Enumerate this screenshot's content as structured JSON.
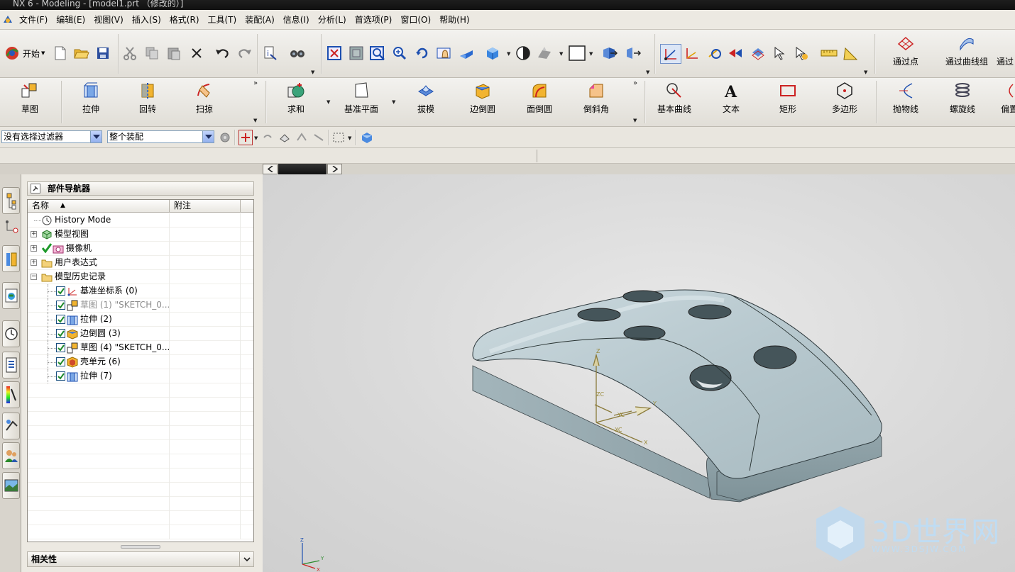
{
  "window": {
    "title": "NX 6 - Modeling - [model1.prt （修改的）]"
  },
  "menu": [
    "文件(F)",
    "编辑(E)",
    "视图(V)",
    "插入(S)",
    "格式(R)",
    "工具(T)",
    "装配(A)",
    "信息(I)",
    "分析(L)",
    "首选项(P)",
    "窗口(O)",
    "帮助(H)"
  ],
  "toolbar_standard": {
    "start_label": "开始",
    "through_points": "通过点",
    "through_curves": "通过曲线组",
    "through_partial": "通过"
  },
  "toolbar_features": {
    "sketch": "草图",
    "extrude": "拉伸",
    "revolve": "回转",
    "sweep": "扫掠",
    "unite": "求和",
    "datum_plane": "基准平面",
    "draft": "拔模",
    "edge_blend": "边倒圆",
    "face_blend": "面倒圆",
    "chamfer": "倒斜角",
    "basic_curves": "基本曲线",
    "text": "文本",
    "rectangle": "矩形",
    "polygon": "多边形",
    "parabola": "抛物线",
    "helix": "螺旋线",
    "offset_partial": "偏置"
  },
  "selection_bar": {
    "filter": "没有选择过滤器",
    "scope": "整个装配"
  },
  "navigator": {
    "title": "部件导航器",
    "col_name": "名称",
    "col_note": "附注",
    "items": [
      {
        "label": "History Mode",
        "icon": "clock-icon",
        "level": 0
      },
      {
        "label": "模型视图",
        "icon": "model-views-icon",
        "level": 0,
        "expander": "+"
      },
      {
        "label": "摄像机",
        "icon": "camera-icon",
        "level": 0,
        "expander": "+"
      },
      {
        "label": "用户表达式",
        "icon": "folder-icon",
        "level": 0,
        "expander": "+"
      },
      {
        "label": "模型历史记录",
        "icon": "folder-icon",
        "level": 0,
        "expander": "−"
      },
      {
        "label": "基准坐标系 (0)",
        "icon": "datum-csys-icon",
        "level": 1
      },
      {
        "label": "草图 (1) \"SKETCH_0...",
        "icon": "sketch-icon",
        "level": 1,
        "dim": true
      },
      {
        "label": "拉伸 (2)",
        "icon": "extrude-icon",
        "level": 1
      },
      {
        "label": "边倒圆 (3)",
        "icon": "edge-blend-icon",
        "level": 1
      },
      {
        "label": "草图 (4) \"SKETCH_0...",
        "icon": "sketch-icon",
        "level": 1
      },
      {
        "label": "壳单元 (6)",
        "icon": "shell-icon",
        "level": 1
      },
      {
        "label": "拉伸 (7)",
        "icon": "extrude-icon",
        "level": 1
      }
    ],
    "dependencies_title": "相关性"
  },
  "viewport": {
    "csys_labels": [
      "ZC",
      "YC",
      "XC",
      "Z",
      "Y",
      "X"
    ],
    "mini_triad": [
      "Z",
      "Y",
      "X"
    ]
  },
  "watermark": {
    "brand": "3D世界网",
    "url": "WWW.3DSJW.COM"
  },
  "colors": {
    "part": "#b9c9cf",
    "part_dark": "#7f9399",
    "accent": "#1f4fae"
  }
}
